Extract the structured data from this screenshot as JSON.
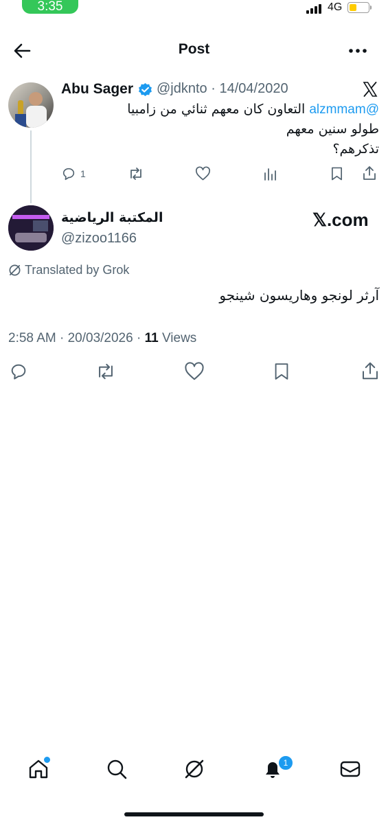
{
  "status_bar": {
    "time": "3:35",
    "network": "4G"
  },
  "header": {
    "title": "Post"
  },
  "quoted_post": {
    "author_name": "Abu Sager",
    "handle": "@jdknto",
    "date": "14/04/2020",
    "mention": "@alzmmam",
    "line1": "التعاون كان معهم ثنائي من زامبيا",
    "line2": "طولو سنين معهم",
    "line3": "تذكرهم؟",
    "reply_count": "1"
  },
  "reply_post": {
    "author_name": "المكتبة الرياضية",
    "handle": "@zizoo1166",
    "watermark": "𝕏.com",
    "translated_by": "Translated by Grok",
    "text": "آرثر لونجو وهاريسون شينجو",
    "timestamp": "2:58 AM · 20/03/2026 · ",
    "views_count": "11",
    "views_label": "Views"
  },
  "tab_bar": {
    "notifications_badge": "1"
  },
  "colors": {
    "accent": "#1d9bf0",
    "muted": "#536471",
    "text": "#0f1419"
  }
}
